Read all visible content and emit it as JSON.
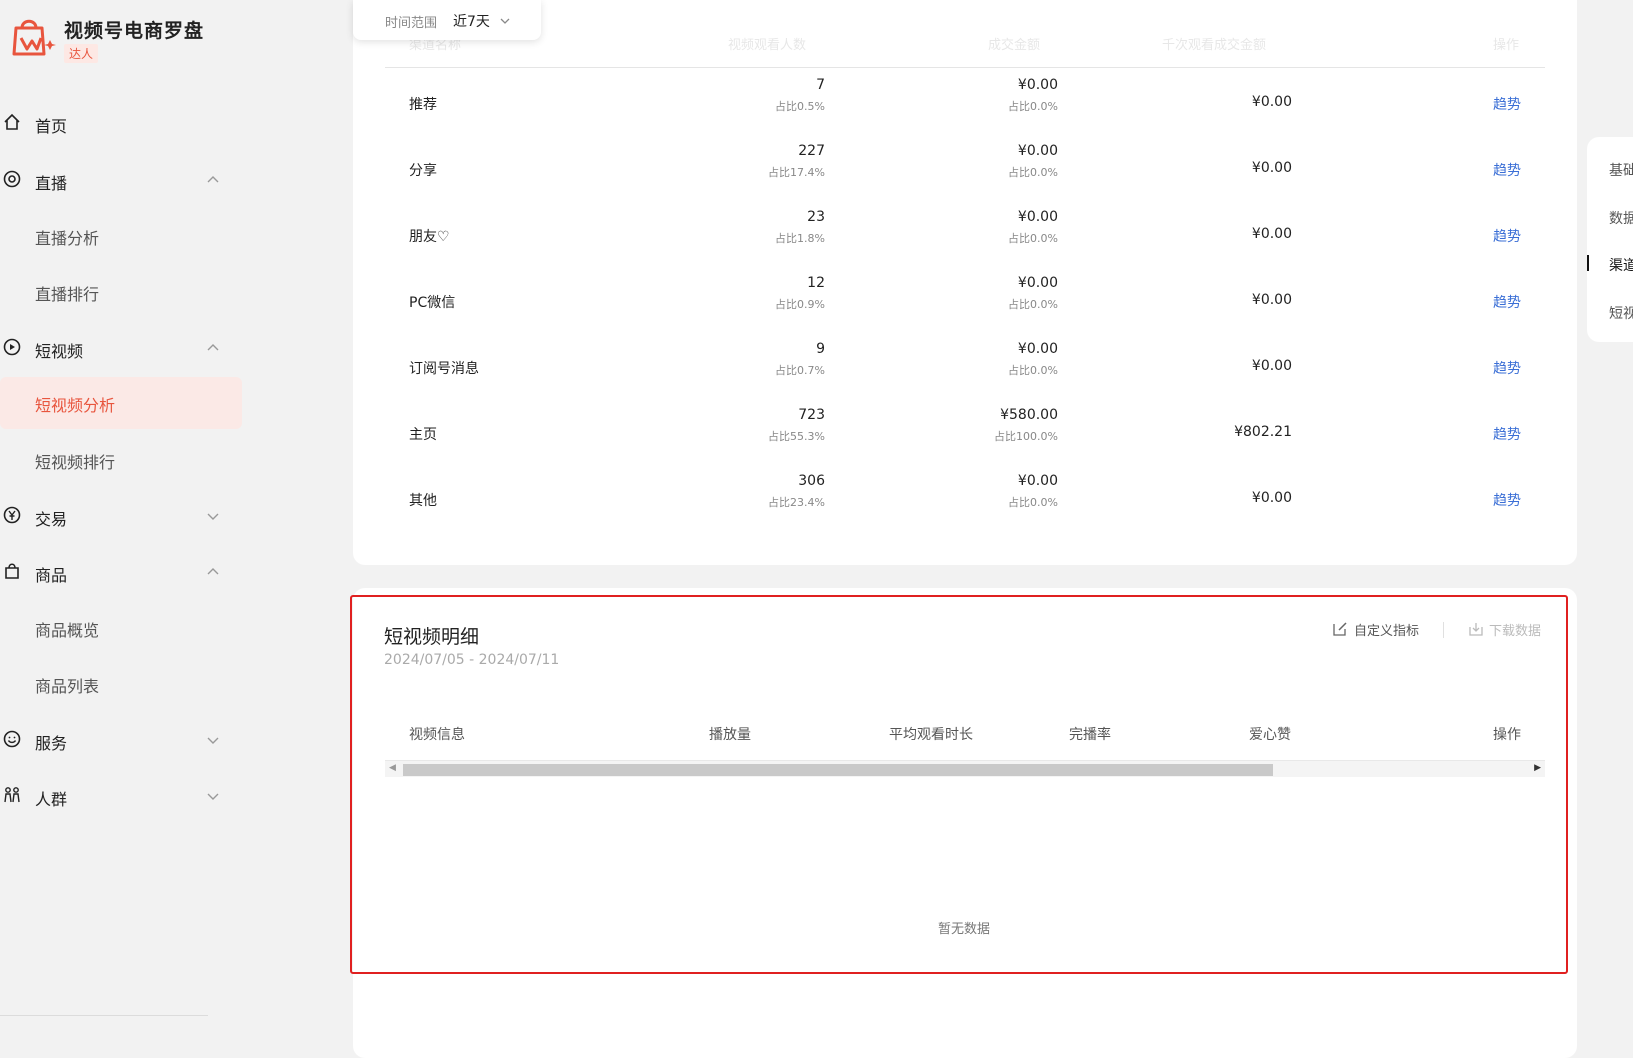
{
  "brand": {
    "title": "视频号电商罗盘",
    "badge": "达人"
  },
  "nav": {
    "home": "首页",
    "live": "直播",
    "live_sub": [
      "直播分析",
      "直播排行"
    ],
    "short_video": "短视频",
    "short_video_sub": [
      "短视频分析",
      "短视频排行"
    ],
    "trade": "交易",
    "goods": "商品",
    "goods_sub": [
      "商品概览",
      "商品列表"
    ],
    "service": "服务",
    "crowd": "人群"
  },
  "time_filter": {
    "label": "时间范围",
    "value": "近7天"
  },
  "channel_table": {
    "headers": [
      "渠道名称",
      "视频观看人数",
      "成交金额",
      "千次观看成交金额",
      "操作"
    ],
    "rows": [
      {
        "name": "推荐",
        "views": "7",
        "views_pct": "占比0.5%",
        "gmv": "¥0.00",
        "gmv_pct": "占比0.0%",
        "per_k": "¥0.00",
        "op": "趋势"
      },
      {
        "name": "分享",
        "views": "227",
        "views_pct": "占比17.4%",
        "gmv": "¥0.00",
        "gmv_pct": "占比0.0%",
        "per_k": "¥0.00",
        "op": "趋势"
      },
      {
        "name": "朋友♡",
        "views": "23",
        "views_pct": "占比1.8%",
        "gmv": "¥0.00",
        "gmv_pct": "占比0.0%",
        "per_k": "¥0.00",
        "op": "趋势"
      },
      {
        "name": "PC微信",
        "views": "12",
        "views_pct": "占比0.9%",
        "gmv": "¥0.00",
        "gmv_pct": "占比0.0%",
        "per_k": "¥0.00",
        "op": "趋势"
      },
      {
        "name": "订阅号消息",
        "views": "9",
        "views_pct": "占比0.7%",
        "gmv": "¥0.00",
        "gmv_pct": "占比0.0%",
        "per_k": "¥0.00",
        "op": "趋势"
      },
      {
        "name": "主页",
        "views": "723",
        "views_pct": "占比55.3%",
        "gmv": "¥580.00",
        "gmv_pct": "占比100.0%",
        "per_k": "¥802.21",
        "op": "趋势"
      },
      {
        "name": "其他",
        "views": "306",
        "views_pct": "占比23.4%",
        "gmv": "¥0.00",
        "gmv_pct": "占比0.0%",
        "per_k": "¥0.00",
        "op": "趋势"
      }
    ]
  },
  "detail": {
    "title": "短视频明细",
    "date_range": "2024/07/05 - 2024/07/11",
    "custom_metrics": "自定义指标",
    "download": "下载数据",
    "headers": [
      "视频信息",
      "播放量",
      "平均观看时长",
      "完播率",
      "爱心赞",
      "操作"
    ],
    "empty_text": "暂无数据"
  },
  "right_nav": {
    "items": [
      "基础",
      "数据",
      "渠道",
      "短视"
    ],
    "active_index": 2
  },
  "colors": {
    "accent": "#e8553e",
    "link": "#3b6fd6",
    "highlight_border": "#e02020"
  }
}
